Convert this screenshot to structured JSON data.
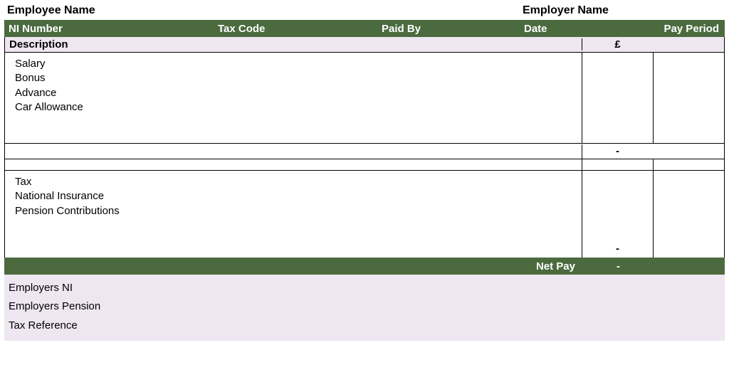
{
  "header": {
    "employee_name_label": "Employee Name",
    "employer_name_label": "Employer Name"
  },
  "greenbar": {
    "ni_number": "NI Number",
    "tax_code": "Tax Code",
    "paid_by": "Paid By",
    "date": "Date",
    "pay_period": "Pay Period"
  },
  "desc_header": {
    "description": "Description",
    "currency": "£"
  },
  "earnings": {
    "items": [
      "Salary",
      "Bonus",
      "Advance",
      "Car Allowance"
    ],
    "subtotal": "-"
  },
  "deductions": {
    "items": [
      "Tax",
      "National Insurance",
      "Pension Contributions"
    ],
    "subtotal": "-"
  },
  "netpay": {
    "label": "Net Pay",
    "value": "-"
  },
  "footer": {
    "employers_ni": "Employers NI",
    "employers_pension": "Employers Pension",
    "tax_reference": "Tax Reference"
  }
}
